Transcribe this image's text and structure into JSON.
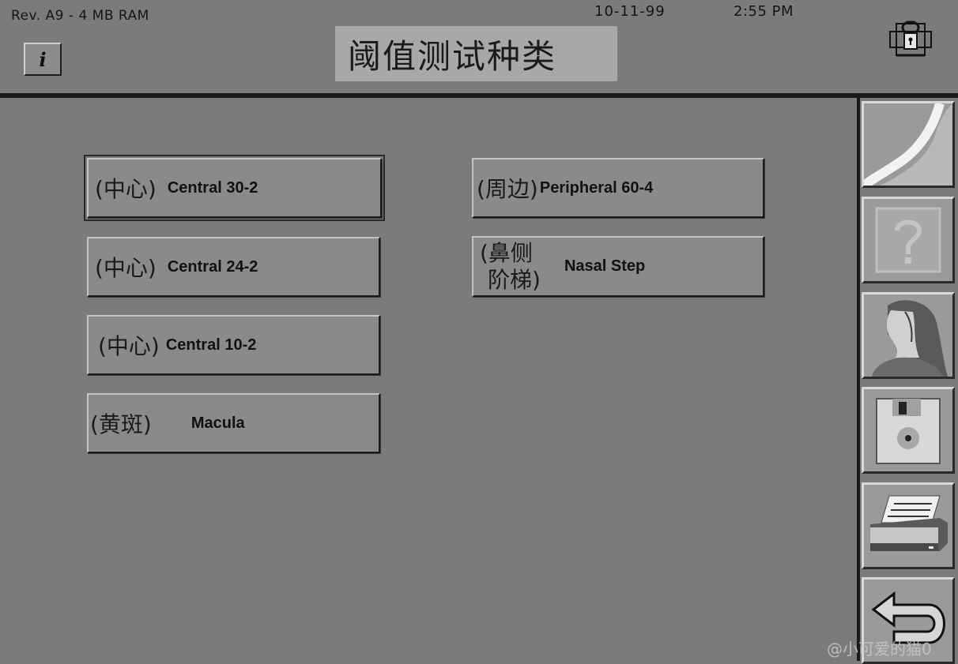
{
  "status_bar": {
    "revision": "Rev. A9 - 4 MB RAM",
    "date": "10-11-99",
    "time": "2:55 PM"
  },
  "header": {
    "title": "阈值测试种类",
    "info_label": "i"
  },
  "tests": {
    "central_30_2": {
      "cn": "(中心)",
      "en": "Central 30-2",
      "selected": true
    },
    "central_24_2": {
      "cn": "(中心)",
      "en": "Central 24-2"
    },
    "central_10_2": {
      "cn": "(中心)",
      "en": "Central 10-2"
    },
    "macula": {
      "cn": "(黄斑)",
      "en": "Macula"
    },
    "peripheral_60_4": {
      "cn": "(周边)",
      "en": "Peripheral 60-4"
    },
    "nasal_step": {
      "cn_line1": "(鼻侧",
      "cn_line2": "阶梯)",
      "en": "Nasal Step"
    }
  },
  "sidebar": {
    "icons": [
      "field-curve-icon",
      "help-question-icon",
      "patient-profile-icon",
      "floppy-disk-icon",
      "printer-icon",
      "return-arrow-icon"
    ]
  },
  "icons": {
    "lock": "lock-icon",
    "info": "info-icon"
  },
  "watermark": "@小可爱的猫0"
}
